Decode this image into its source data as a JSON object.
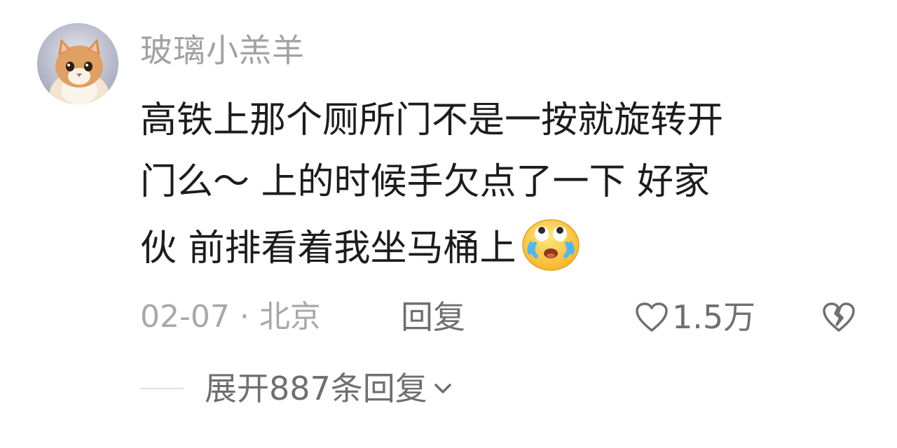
{
  "comment": {
    "username": "玻璃小羔羊",
    "text_lines": [
      "高铁上那个厕所门不是一按就旋转开",
      "门么～ 上的时候手欠点了一下  好家",
      "伙 前排看着我坐马桶上"
    ],
    "emoji": "crying-laughing-emoji",
    "date_location": "02-07 · 北京",
    "reply_label": "回复",
    "like_count": "1.5万",
    "expand_replies_label": "展开887条回复"
  },
  "colors": {
    "username": "#a2a2a2",
    "text": "#1c1c1c",
    "meta": "#a8a8a8",
    "action": "#6f6f6f",
    "divider": "#dedede"
  },
  "icons": {
    "like": "heart-outline-icon",
    "dislike": "broken-heart-icon",
    "expand": "chevron-down-icon"
  }
}
